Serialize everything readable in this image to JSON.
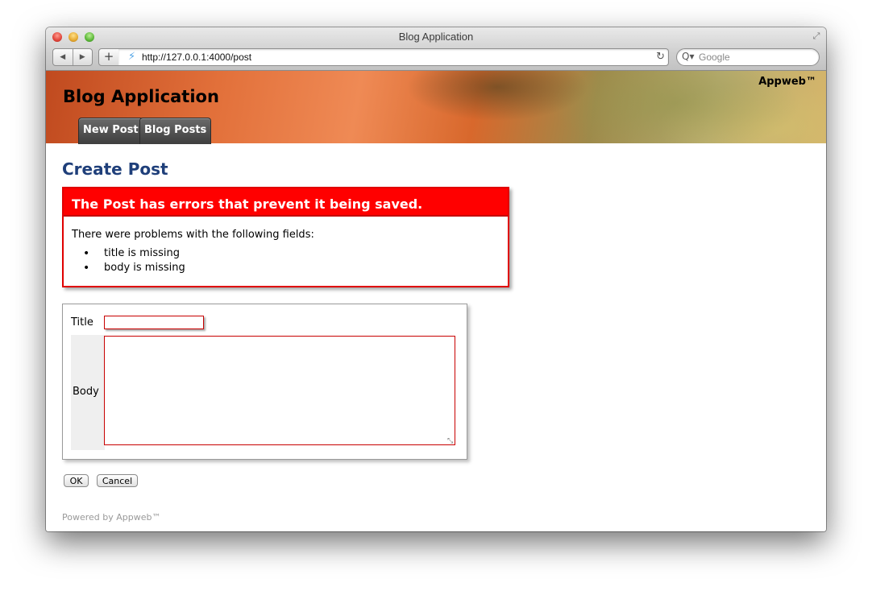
{
  "window": {
    "title": "Blog Application"
  },
  "toolbar": {
    "back_icon": "◀",
    "forward_icon": "▶",
    "add_icon": "+",
    "url": "http://127.0.0.1:4000/post",
    "reload_icon": "↻",
    "search_placeholder": "Google",
    "search_icon": "Q▾"
  },
  "header": {
    "brand": "Appweb™",
    "app_title": "Blog Application",
    "tabs": [
      {
        "label": "New Post"
      },
      {
        "label": "Blog Posts"
      }
    ]
  },
  "main": {
    "page_title": "Create Post",
    "errors": {
      "heading": "The Post has errors that prevent it being saved.",
      "intro": "There were problems with the following fields:",
      "items": [
        "title is missing",
        "body is missing"
      ]
    },
    "form": {
      "title_label": "Title",
      "body_label": "Body",
      "title_value": "",
      "body_value": ""
    },
    "buttons": {
      "ok_label": "OK",
      "cancel_label": "Cancel"
    }
  },
  "footer": {
    "text": "Powered by Appweb™"
  },
  "colors": {
    "error_red": "#ff0000",
    "title_blue": "#1f3f7a",
    "tab_bg": "#4e4e4e"
  }
}
